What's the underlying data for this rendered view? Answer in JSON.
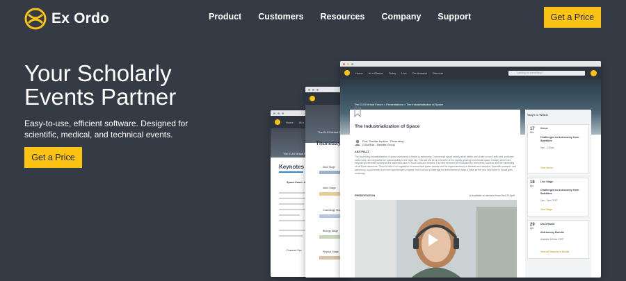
{
  "brand": {
    "name": "Ex Ordo",
    "accent": "#fcc214",
    "background": "#353b45"
  },
  "nav": {
    "items": [
      "Product",
      "Customers",
      "Resources",
      "Company",
      "Support"
    ],
    "cta": "Get a Price"
  },
  "hero": {
    "title": "Your Scholarly Events Partner",
    "subtitle": "Easy-to-use, efficient software. Designed for scientific, medical, and technical events.",
    "cta": "Get a Price"
  },
  "mockup_back": {
    "nav": [
      "Home",
      "At a"
    ],
    "crumb": "The ELSI Virtual F",
    "panel_title": "Keynotes",
    "item_title": "Space Panel: Aff Affects Care C",
    "footer": "Featured Spe"
  },
  "mockup_middle": {
    "crumb": "The ELSI Virtual F",
    "day": "Thursday",
    "stages": [
      "Main Stage",
      "Astro Stage",
      "Cosmology Stage",
      "Biology Stage",
      "Physics Stage"
    ]
  },
  "mockup_front": {
    "nav": [
      "Home",
      "At a Glance",
      "Today",
      "Live",
      "On-demand",
      "Discover"
    ],
    "search_placeholder": "Looking for something?",
    "crumb": "The ELSI Virtual Forum  >  Presentations  >  The Industrialization of Space",
    "title": "The Industrialization of Space",
    "author": "Prof. Danika Jenkins · Presenting",
    "affiliation": "Columbia - Satellite Group",
    "abstract_label": "ABSTRACT",
    "abstract": "The impending industrialization of space represents a threat to astronomy. Commercial space activity adds debris and clutter to low Earth orbit, produces radio noise, and degrades the optical quality of the night sky. This talk will be an overview of the rapidly growing commercial space industry which has eclipsed government activity as the dominant force in Earth orbit and beyond. The new ventures are motivated by commerce, tourism, and the harvesting of off-Earth resources. There is little to no regulation of commercial space activity and the legal framework is skeletal and untested. Scientific research, and astronomy, could benefit from new opportunities in space, but it will be a challenge for astronomers to have a voice as the new Wild West in Space gets underway.",
    "presentation_label": "PRESENTATION",
    "availability": "Available on demand from Sun 29 April",
    "sidebar_title": "Ways to Watch",
    "watch": [
      {
        "day": "17",
        "month": "Nov",
        "tag": "Venue",
        "title": "Challenges to Astronomy from Satellites",
        "time": "9am - 3:30am",
        "link": "View Venue"
      },
      {
        "day": "18",
        "month": "Apr",
        "tag": "Live Stage",
        "title": "Challenges to Astronomy from Satellites",
        "time": "2pm - 3pm CEST",
        "link": "View Stage"
      },
      {
        "day": "29",
        "month": "Apr",
        "tag": "On-Demand",
        "title": "Astronomy Bundle",
        "time": "Available 8:00am CEST",
        "link": "View all Sessions in Bundle"
      }
    ]
  }
}
